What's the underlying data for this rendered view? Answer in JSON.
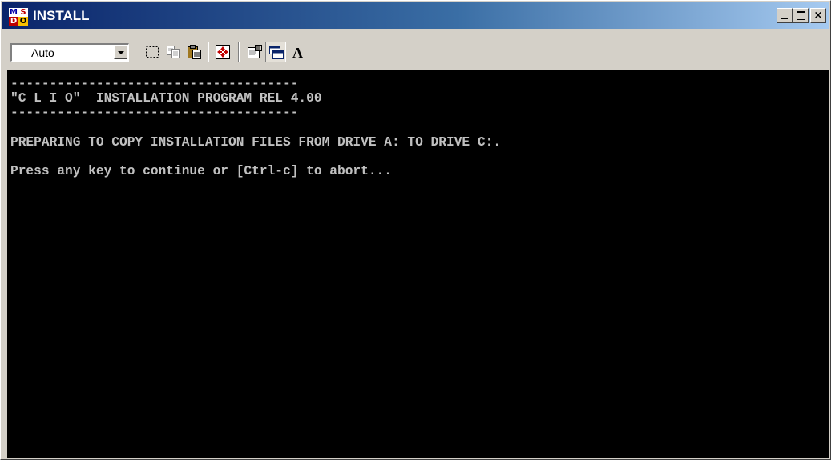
{
  "window": {
    "title": "INSTALL",
    "icon_text": [
      "M",
      "S",
      "D",
      "O"
    ],
    "controls": {
      "close_glyph": "×"
    }
  },
  "toolbar": {
    "font_size_value": "Auto",
    "buttons": [
      "mark-icon",
      "copy-icon",
      "paste-icon",
      "fullscreen-icon",
      "properties-icon",
      "background-icon",
      "font-icon"
    ],
    "font_button_label": "A"
  },
  "console": {
    "lines": [
      "-------------------------------------",
      "\"C L I O\"  INSTALLATION PROGRAM REL 4.00",
      "-------------------------------------",
      "",
      "PREPARING TO COPY INSTALLATION FILES FROM DRIVE A: TO DRIVE C:.",
      "",
      "Press any key to continue or [Ctrl-c] to abort..."
    ]
  },
  "colors": {
    "titlebar_start": "#0a246a",
    "titlebar_end": "#a6caf0",
    "console_bg": "#000000",
    "console_text": "#c0c0c0",
    "chrome": "#d4d0c8"
  }
}
